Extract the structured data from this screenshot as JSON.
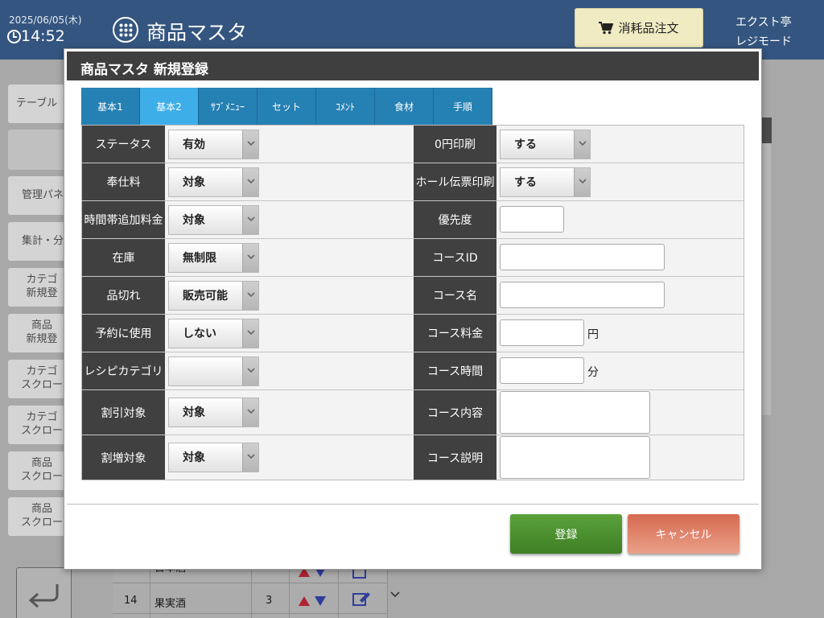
{
  "header": {
    "date": "2025/06/05(木)",
    "time": "14:52",
    "app_title": "商品マスタ",
    "order_button": "消耗品注文",
    "store_name": "エクスト亭",
    "mode": "レジモード"
  },
  "side_menu": [
    {
      "label": "テーブル"
    },
    {
      "label": ""
    },
    {
      "label": "管理パネ"
    },
    {
      "label": "集計・分"
    },
    {
      "label": "カテゴ\n新規登"
    },
    {
      "label": "商品\n新規登"
    },
    {
      "label": "カテゴ\nスクロー"
    },
    {
      "label": "カテゴ\nスクロー"
    },
    {
      "label": "商品\nスクロー"
    },
    {
      "label": "商品\nスクロー"
    }
  ],
  "background_table": {
    "rows": [
      {
        "no": "",
        "name": "日本酒",
        "count": ""
      },
      {
        "no": "14",
        "name": "果実酒",
        "count": "3"
      }
    ]
  },
  "modal": {
    "title": "商品マスタ 新規登録",
    "tabs": [
      {
        "label": "基本1",
        "active": false
      },
      {
        "label": "基本2",
        "active": true
      },
      {
        "label": "ｻﾌﾞﾒﾆｭｰ",
        "active": false
      },
      {
        "label": "セット",
        "active": false
      },
      {
        "label": "ｺﾒﾝﾄ",
        "active": false
      },
      {
        "label": "食材",
        "active": false
      },
      {
        "label": "手順",
        "active": false
      }
    ],
    "left_fields": [
      {
        "label": "ステータス",
        "value": "有効"
      },
      {
        "label": "奉仕料",
        "value": "対象"
      },
      {
        "label": "時間帯追加料金",
        "value": "対象"
      },
      {
        "label": "在庫",
        "value": "無制限"
      },
      {
        "label": "品切れ",
        "value": "販売可能"
      },
      {
        "label": "予約に使用",
        "value": "しない"
      },
      {
        "label": "レシピカテゴリ",
        "value": ""
      },
      {
        "label": "割引対象",
        "value": "対象"
      },
      {
        "label": "割増対象",
        "value": "対象"
      }
    ],
    "right_fields": [
      {
        "label": "0円印刷",
        "value": "する"
      },
      {
        "label": "ホール伝票印刷",
        "value": "する"
      },
      {
        "label": "優先度",
        "value": ""
      },
      {
        "label": "コースID",
        "value": ""
      },
      {
        "label": "コース名",
        "value": ""
      },
      {
        "label": "コース料金",
        "value": "",
        "unit": "円"
      },
      {
        "label": "コース時間",
        "value": "",
        "unit": "分"
      },
      {
        "label": "コース内容",
        "value": ""
      },
      {
        "label": "コース説明",
        "value": ""
      }
    ],
    "buttons": {
      "submit": "登録",
      "cancel": "キャンセル"
    }
  },
  "colors": {
    "header_bg": "#34557f",
    "tab_bg": "#2580b3",
    "tab_active_bg": "#3eaee8",
    "label_bg": "#404040",
    "submit_bg": "#4a8e2e",
    "cancel_bg": "#e0826a"
  }
}
